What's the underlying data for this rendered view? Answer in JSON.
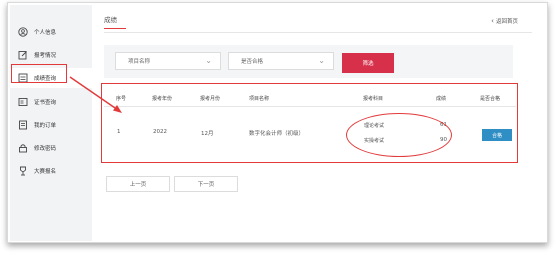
{
  "sidebar": {
    "items": [
      {
        "label": "个人信息",
        "icon": "user-icon"
      },
      {
        "label": "报考情况",
        "icon": "edit-icon"
      },
      {
        "label": "成绩查询",
        "icon": "score-icon"
      },
      {
        "label": "证书查询",
        "icon": "certificate-icon"
      },
      {
        "label": "我的订单",
        "icon": "order-icon"
      },
      {
        "label": "修改密码",
        "icon": "lock-icon"
      },
      {
        "label": "大赛报名",
        "icon": "trophy-icon"
      }
    ]
  },
  "header": {
    "title": "成绩",
    "back_label": "返回首页"
  },
  "filters": {
    "project_placeholder": "项目名称",
    "pass_placeholder": "是否合格",
    "filter_button": "筛选"
  },
  "table": {
    "columns": [
      "序号",
      "报考年份",
      "报考月份",
      "项目名称",
      "报考科目",
      "成绩",
      "是否合格"
    ],
    "rows": [
      {
        "index": "1",
        "year": "2022",
        "month": "12月",
        "project": "数字化会计师（初级）",
        "subjects": [
          {
            "name": "理论考试",
            "score": "61"
          },
          {
            "name": "实操考试",
            "score": "90"
          }
        ],
        "pass": "合格"
      }
    ]
  },
  "pagination": {
    "prev": "上一页",
    "next": "下一页"
  },
  "colors": {
    "accent": "#d6304a",
    "highlight": "#e23a3a",
    "badge": "#2f8fc5"
  }
}
